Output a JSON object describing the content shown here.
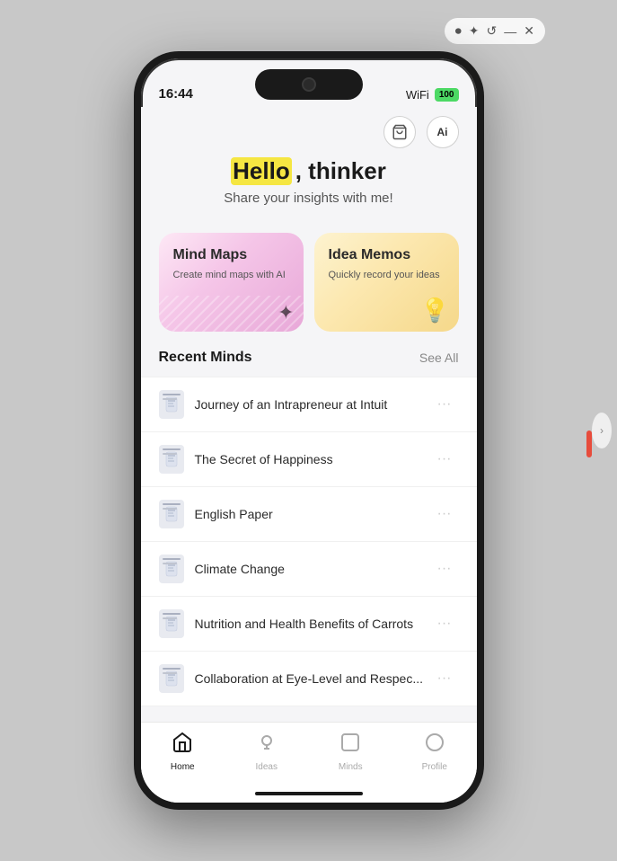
{
  "desktop": {
    "background": "#c8c8c8"
  },
  "status_bar": {
    "time": "16:44",
    "wifi": "WiFi",
    "battery": "100"
  },
  "header": {
    "basket_icon": "🛍",
    "ai_icon": "Ai"
  },
  "hero": {
    "greeting_prefix": "Hello, thinker",
    "hello_text": "Hello",
    "comma_text": ", thinker",
    "subtitle": "Share your insights with me!"
  },
  "cards": [
    {
      "id": "mind-maps",
      "title": "Mind Maps",
      "subtitle": "Create mind maps with AI",
      "decoration": "✦"
    },
    {
      "id": "idea-memos",
      "title": "Idea Memos",
      "subtitle": "Quickly record your ideas",
      "decoration": "💡"
    }
  ],
  "recent_section": {
    "title": "Recent Minds",
    "see_all": "See All"
  },
  "recent_items": [
    {
      "id": 1,
      "title": "Journey of an Intrapreneur at Intuit",
      "more": "···"
    },
    {
      "id": 2,
      "title": "The Secret of Happiness",
      "more": "···"
    },
    {
      "id": 3,
      "title": "English Paper",
      "more": "···"
    },
    {
      "id": 4,
      "title": "Climate Change",
      "more": "···"
    },
    {
      "id": 5,
      "title": "Nutrition and Health Benefits of Carrots",
      "more": "···"
    },
    {
      "id": 6,
      "title": "Collaboration at Eye-Level and Respec...",
      "more": "···"
    }
  ],
  "bottom_nav": [
    {
      "id": "home",
      "label": "Home",
      "icon": "⌂",
      "active": true
    },
    {
      "id": "ideas",
      "label": "Ideas",
      "icon": "💡",
      "active": false
    },
    {
      "id": "minds",
      "label": "Minds",
      "icon": "⬜",
      "active": false
    },
    {
      "id": "profile",
      "label": "Profile",
      "icon": "⬜",
      "active": false
    }
  ]
}
